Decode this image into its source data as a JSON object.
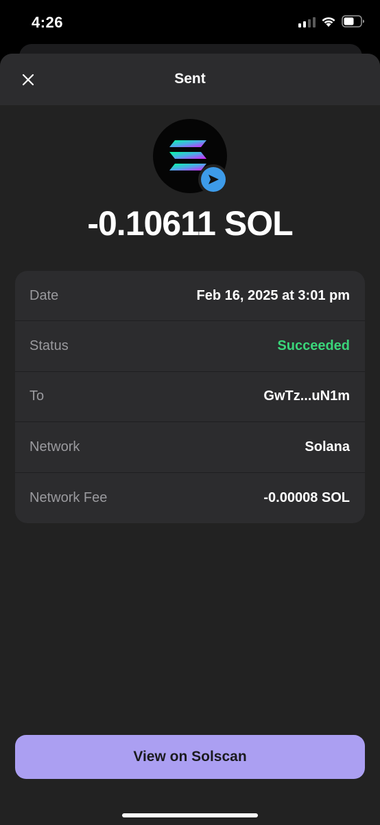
{
  "status_bar": {
    "time": "4:26",
    "icons": [
      "signal-icon",
      "wifi-icon",
      "battery-icon"
    ]
  },
  "header": {
    "title": "Sent",
    "close_icon": "close-icon"
  },
  "token": {
    "icon": "solana-logo",
    "badge_icon": "send-icon"
  },
  "amount": "-0.10611 SOL",
  "details": {
    "rows": [
      {
        "label": "Date",
        "value": "Feb 16, 2025 at 3:01 pm"
      },
      {
        "label": "Status",
        "value": "Succeeded"
      },
      {
        "label": "To",
        "value": "GwTz...uN1m"
      },
      {
        "label": "Network",
        "value": "Solana"
      },
      {
        "label": "Network Fee",
        "value": "-0.00008 SOL"
      }
    ]
  },
  "actions": {
    "view_button_label": "View on Solscan"
  },
  "colors": {
    "sheet_bg": "#222222",
    "card_bg": "#2c2c2e",
    "success": "#3ad57a",
    "accent": "#ab9ff2",
    "send_badge": "#3d9be9"
  }
}
